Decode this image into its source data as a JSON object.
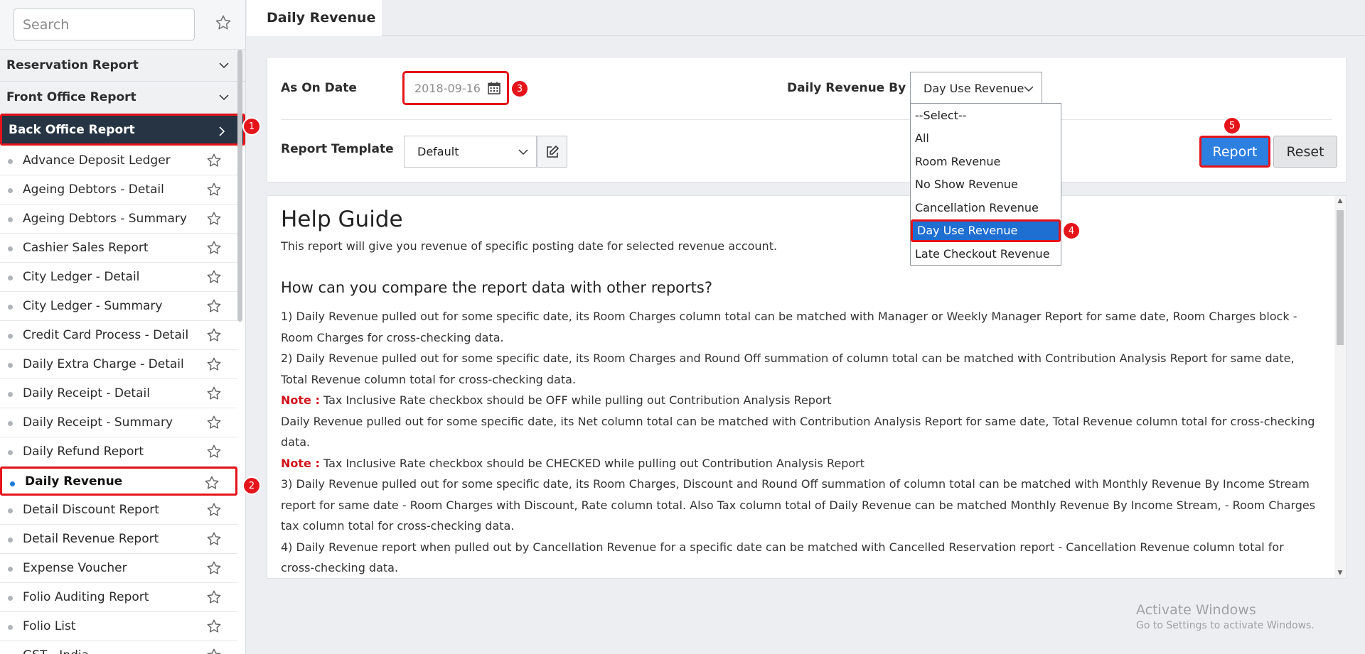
{
  "sidebar": {
    "search_placeholder": "Search",
    "categories": [
      {
        "label": "Reservation Report"
      },
      {
        "label": "Front Office Report"
      },
      {
        "label": "Back Office Report"
      }
    ],
    "items": [
      {
        "label": "Advance Deposit Ledger"
      },
      {
        "label": "Ageing Debtors - Detail"
      },
      {
        "label": "Ageing Debtors - Summary"
      },
      {
        "label": "Cashier Sales Report"
      },
      {
        "label": "City Ledger - Detail"
      },
      {
        "label": "City Ledger - Summary"
      },
      {
        "label": "Credit Card Process - Detail"
      },
      {
        "label": "Daily Extra Charge - Detail"
      },
      {
        "label": "Daily Receipt - Detail"
      },
      {
        "label": "Daily Receipt - Summary"
      },
      {
        "label": "Daily Refund Report"
      },
      {
        "label": "Daily Revenue"
      },
      {
        "label": "Detail Discount Report"
      },
      {
        "label": "Detail Revenue Report"
      },
      {
        "label": "Expense Voucher"
      },
      {
        "label": "Folio Auditing Report"
      },
      {
        "label": "Folio List"
      },
      {
        "label": "GST - India"
      }
    ]
  },
  "tab": {
    "title": "Daily Revenue"
  },
  "form": {
    "as_on_date_label": "As On Date",
    "as_on_date_value": "2018-09-16",
    "revenue_by_label": "Daily Revenue By",
    "revenue_by_value": "Day Use Revenue",
    "revenue_by_options": [
      "--Select--",
      "All",
      "Room Revenue",
      "No Show Revenue",
      "Cancellation Revenue",
      "Day Use Revenue",
      "Late Checkout Revenue"
    ],
    "template_label": "Report Template",
    "template_value": "Default",
    "report_button": "Report",
    "reset_button": "Reset"
  },
  "badges": [
    "1",
    "2",
    "3",
    "4",
    "5"
  ],
  "help": {
    "title": "Help Guide",
    "intro": "This report will give you revenue of specific posting date for selected revenue account.",
    "heading": "How can you compare the report data with other reports?",
    "p1": "1) Daily Revenue pulled out for some specific date, its Room Charges column total can be matched with Manager or Weekly Manager Report for same date, Room Charges block - Room Charges for cross-checking data.",
    "p2": "2) Daily Revenue pulled out for some specific date, its Room Charges and Round Off summation of column total can be matched with Contribution Analysis Report for same date, Total Revenue column total for cross-checking data.",
    "note_label": "Note :",
    "note1": "Tax Inclusive Rate checkbox should be OFF while pulling out Contribution Analysis Report",
    "p3": "Daily Revenue pulled out for some specific date, its Net column total can be matched with Contribution Analysis Report for same date, Total Revenue column total for cross-checking data.",
    "note2": "Tax Inclusive Rate checkbox should be CHECKED while pulling out Contribution Analysis Report",
    "p4": "3) Daily Revenue pulled out for some specific date, its Room Charges, Discount and Round Off summation of column total can be matched with Monthly Revenue By Income Stream report for same date - Room Charges with Discount, Rate column total. Also Tax column total of Daily Revenue can be matched Monthly Revenue By Income Stream, - Room Charges tax column total for cross-checking data.",
    "p5": "4) Daily Revenue report when pulled out by Cancellation Revenue for a specific date can be matched with Cancelled Reservation report - Cancellation Revenue column total for cross-checking data."
  },
  "watermark": {
    "line1": "Activate Windows",
    "line2": "Go to Settings to activate Windows."
  },
  "colors": {
    "accent": "#2d7fe0",
    "highlight": "#e5141b",
    "sidebar_active": "#263444"
  }
}
